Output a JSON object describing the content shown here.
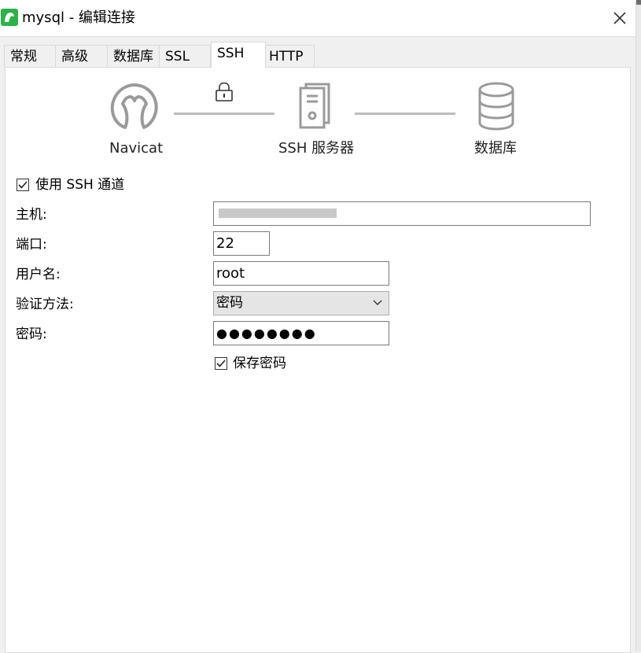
{
  "window": {
    "title": "mysql - 编辑连接",
    "accent": "#2bb34a"
  },
  "tabs": [
    {
      "label": "常规"
    },
    {
      "label": "高级"
    },
    {
      "label": "数据库"
    },
    {
      "label": "SSL"
    },
    {
      "label": "SSH",
      "active": true
    },
    {
      "label": "HTTP"
    }
  ],
  "diagram": {
    "client_label": "Navicat",
    "server_label": "SSH 服务器",
    "database_label": "数据库"
  },
  "form": {
    "use_ssh": {
      "label": "使用 SSH 通道",
      "checked": true
    },
    "host": {
      "label": "主机:",
      "value": ""
    },
    "port": {
      "label": "端口:",
      "value": "22"
    },
    "username": {
      "label": "用户名:",
      "value": "root"
    },
    "auth_method": {
      "label": "验证方法:",
      "value": "密码"
    },
    "password": {
      "label": "密码:",
      "value": "●●●●●●●●"
    },
    "save_password": {
      "label": "保存密码",
      "checked": true
    }
  }
}
